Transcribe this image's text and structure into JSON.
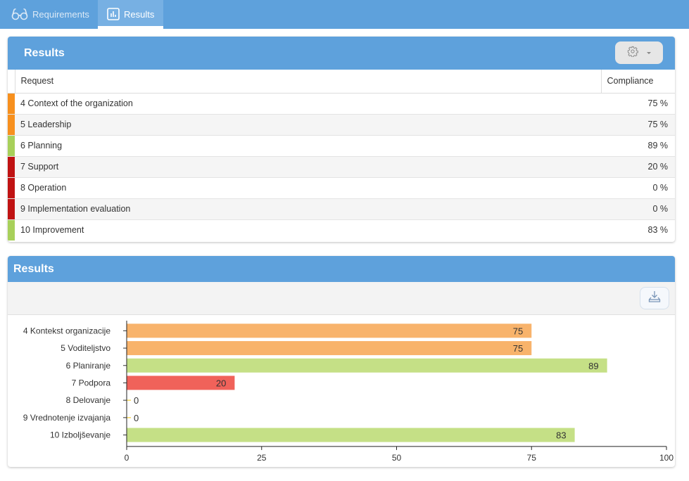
{
  "nav": {
    "tabs": [
      {
        "label": "Requirements",
        "icon": "glasses-icon",
        "active": false
      },
      {
        "label": "Results",
        "icon": "bar-chart-icon",
        "active": true
      }
    ]
  },
  "results_table": {
    "title": "Results",
    "settings_icon": "gear-icon",
    "columns": [
      "Request",
      "Compliance"
    ],
    "rows": [
      {
        "request": "4 Context of the organization",
        "compliance": "75 %",
        "status_color": "#f7901e"
      },
      {
        "request": "5 Leadership",
        "compliance": "75 %",
        "status_color": "#f7901e"
      },
      {
        "request": "6 Planning",
        "compliance": "89 %",
        "status_color": "#a8d05a"
      },
      {
        "request": "7 Support",
        "compliance": "20 %",
        "status_color": "#c01313"
      },
      {
        "request": "8 Operation",
        "compliance": "0 %",
        "status_color": "#c01313"
      },
      {
        "request": "9 Implementation evaluation",
        "compliance": "0 %",
        "status_color": "#c01313"
      },
      {
        "request": "10 Improvement",
        "compliance": "83 %",
        "status_color": "#a8d05a"
      }
    ]
  },
  "results_chart_panel": {
    "title": "Results",
    "download_icon": "download-icon"
  },
  "chart_data": {
    "type": "bar",
    "orientation": "horizontal",
    "title": "",
    "xlabel": "",
    "ylabel": "",
    "categories": [
      "4 Kontekst organizacije",
      "5 Voditeljstvo",
      "6 Planiranje",
      "7 Podpora",
      "8 Delovanje",
      "9 Vrednotenje izvajanja",
      "10 Izboljševanje"
    ],
    "values": [
      75,
      75,
      89,
      20,
      0,
      0,
      83
    ],
    "bar_colors": [
      "#f8b36b",
      "#f8b36b",
      "#c5e086",
      "#f0625a",
      "#f5d75a",
      "#f5d75a",
      "#c5e086"
    ],
    "data_labels": [
      "75",
      "75",
      "89",
      "20",
      "0",
      "0",
      "83"
    ],
    "xlim": [
      0,
      100
    ],
    "xticks": [
      0,
      25,
      50,
      75,
      100
    ],
    "grid": false,
    "legend": "none"
  }
}
